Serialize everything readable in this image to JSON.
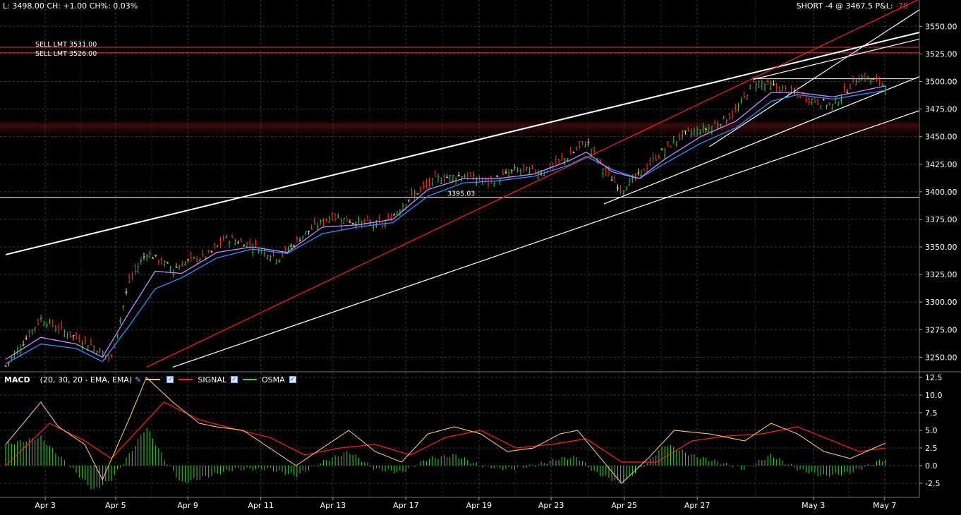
{
  "header": {
    "left": "L: 3498.00 CH: +1.00 CH%: 0.03%",
    "right_prefix": "SHORT -4 @ 3467.5 P&L:",
    "right_pnl": "-78"
  },
  "colors": {
    "background": "#000000",
    "grid": "#3a3a3a",
    "bull_candle": "#3cc33c",
    "bear_candle": "#ff3030",
    "doji": "#ffffff",
    "ema_fast": "#c58cff",
    "ema_slow": "#2f8fff",
    "macd_line": "#f5c46a",
    "signal_line": "#ff2020",
    "osma": "#39d639",
    "trend_red": "#ff2020",
    "trend_white": "#ffffff",
    "shade_zone": "#3d0c0c"
  },
  "orders": [
    {
      "label": "SELL LMT 3531.00",
      "price": 3531
    },
    {
      "label": "SELL LMT 3526.00",
      "price": 3526
    }
  ],
  "annotation": {
    "label": "3395.03",
    "price": 3395.03
  },
  "legend": {
    "name": "MACD",
    "params": "(20, 30, 20 - EMA, EMA)",
    "signal": "SIGNAL",
    "osma": "OSMA"
  },
  "chart_data": [
    {
      "type": "candlestick",
      "title": "",
      "x_tick_labels": [
        "Apr 3",
        "Apr 5",
        "Apr 9",
        "Apr 11",
        "Apr 13",
        "Apr 17",
        "Apr 19",
        "Apr 23",
        "Apr 25",
        "Apr 27",
        "May 3",
        "May 7"
      ],
      "y_tick_labels": [
        "3550.00",
        "3525.00",
        "3500.00",
        "3475.00",
        "3450.00",
        "3425.00",
        "3400.00",
        "3375.00",
        "3350.00",
        "3325.00",
        "3300.00",
        "3275.00",
        "3250.00"
      ],
      "ylim": [
        3240,
        3563
      ],
      "grid": true,
      "close_path": [
        {
          "t": 0,
          "v": 3242
        },
        {
          "t": 0.04,
          "v": 3285
        },
        {
          "t": 0.07,
          "v": 3272
        },
        {
          "t": 0.1,
          "v": 3260
        },
        {
          "t": 0.12,
          "v": 3248
        },
        {
          "t": 0.14,
          "v": 3318
        },
        {
          "t": 0.16,
          "v": 3345
        },
        {
          "t": 0.19,
          "v": 3330
        },
        {
          "t": 0.21,
          "v": 3338
        },
        {
          "t": 0.23,
          "v": 3342
        },
        {
          "t": 0.25,
          "v": 3358
        },
        {
          "t": 0.28,
          "v": 3352
        },
        {
          "t": 0.31,
          "v": 3340
        },
        {
          "t": 0.34,
          "v": 3362
        },
        {
          "t": 0.37,
          "v": 3378
        },
        {
          "t": 0.4,
          "v": 3372
        },
        {
          "t": 0.43,
          "v": 3370
        },
        {
          "t": 0.46,
          "v": 3395
        },
        {
          "t": 0.49,
          "v": 3412
        },
        {
          "t": 0.52,
          "v": 3415
        },
        {
          "t": 0.55,
          "v": 3408
        },
        {
          "t": 0.58,
          "v": 3420
        },
        {
          "t": 0.61,
          "v": 3418
        },
        {
          "t": 0.64,
          "v": 3432
        },
        {
          "t": 0.66,
          "v": 3446
        },
        {
          "t": 0.68,
          "v": 3420
        },
        {
          "t": 0.7,
          "v": 3402
        },
        {
          "t": 0.72,
          "v": 3415
        },
        {
          "t": 0.74,
          "v": 3432
        },
        {
          "t": 0.77,
          "v": 3452
        },
        {
          "t": 0.8,
          "v": 3458
        },
        {
          "t": 0.83,
          "v": 3472
        },
        {
          "t": 0.85,
          "v": 3500
        },
        {
          "t": 0.88,
          "v": 3494
        },
        {
          "t": 0.91,
          "v": 3485
        },
        {
          "t": 0.94,
          "v": 3478
        },
        {
          "t": 0.97,
          "v": 3505
        },
        {
          "t": 1.0,
          "v": 3498
        }
      ],
      "ema_fast_path": [
        {
          "t": 0,
          "v": 3248
        },
        {
          "t": 0.04,
          "v": 3268
        },
        {
          "t": 0.08,
          "v": 3262
        },
        {
          "t": 0.11,
          "v": 3250
        },
        {
          "t": 0.14,
          "v": 3290
        },
        {
          "t": 0.17,
          "v": 3328
        },
        {
          "t": 0.2,
          "v": 3326
        },
        {
          "t": 0.24,
          "v": 3345
        },
        {
          "t": 0.28,
          "v": 3350
        },
        {
          "t": 0.32,
          "v": 3345
        },
        {
          "t": 0.36,
          "v": 3368
        },
        {
          "t": 0.4,
          "v": 3370
        },
        {
          "t": 0.44,
          "v": 3375
        },
        {
          "t": 0.48,
          "v": 3402
        },
        {
          "t": 0.52,
          "v": 3412
        },
        {
          "t": 0.56,
          "v": 3412
        },
        {
          "t": 0.6,
          "v": 3416
        },
        {
          "t": 0.64,
          "v": 3428
        },
        {
          "t": 0.66,
          "v": 3436
        },
        {
          "t": 0.69,
          "v": 3418
        },
        {
          "t": 0.72,
          "v": 3412
        },
        {
          "t": 0.75,
          "v": 3430
        },
        {
          "t": 0.79,
          "v": 3450
        },
        {
          "t": 0.83,
          "v": 3464
        },
        {
          "t": 0.87,
          "v": 3490
        },
        {
          "t": 0.9,
          "v": 3490
        },
        {
          "t": 0.94,
          "v": 3486
        },
        {
          "t": 1.0,
          "v": 3496
        }
      ],
      "ema_slow_path": [
        {
          "t": 0,
          "v": 3244
        },
        {
          "t": 0.04,
          "v": 3262
        },
        {
          "t": 0.08,
          "v": 3258
        },
        {
          "t": 0.11,
          "v": 3246
        },
        {
          "t": 0.14,
          "v": 3278
        },
        {
          "t": 0.17,
          "v": 3312
        },
        {
          "t": 0.2,
          "v": 3322
        },
        {
          "t": 0.24,
          "v": 3340
        },
        {
          "t": 0.28,
          "v": 3348
        },
        {
          "t": 0.32,
          "v": 3344
        },
        {
          "t": 0.36,
          "v": 3362
        },
        {
          "t": 0.4,
          "v": 3368
        },
        {
          "t": 0.44,
          "v": 3372
        },
        {
          "t": 0.48,
          "v": 3396
        },
        {
          "t": 0.52,
          "v": 3408
        },
        {
          "t": 0.56,
          "v": 3410
        },
        {
          "t": 0.6,
          "v": 3414
        },
        {
          "t": 0.64,
          "v": 3424
        },
        {
          "t": 0.66,
          "v": 3432
        },
        {
          "t": 0.69,
          "v": 3420
        },
        {
          "t": 0.72,
          "v": 3412
        },
        {
          "t": 0.75,
          "v": 3426
        },
        {
          "t": 0.79,
          "v": 3444
        },
        {
          "t": 0.83,
          "v": 3458
        },
        {
          "t": 0.87,
          "v": 3482
        },
        {
          "t": 0.9,
          "v": 3488
        },
        {
          "t": 0.94,
          "v": 3484
        },
        {
          "t": 1.0,
          "v": 3492
        }
      ],
      "horizontal_levels": [
        3531,
        3526,
        3502.5,
        3395.03
      ],
      "shaded_zone": {
        "from": 3445,
        "to": 3467
      },
      "trend_lines": [
        {
          "color": "white",
          "from": {
            "t": 0,
            "v": 3343
          },
          "to": {
            "t": 1.0,
            "v": 3537
          }
        },
        {
          "color": "red",
          "from": {
            "t": 0.16,
            "v": 3241
          },
          "to": {
            "t": 1.0,
            "v": 3560
          }
        },
        {
          "color": "white",
          "from": {
            "t": 0.19,
            "v": 3241
          },
          "to": {
            "t": 1.0,
            "v": 3463
          }
        },
        {
          "color": "white",
          "from": {
            "t": 0.68,
            "v": 3389
          },
          "to": {
            "t": 1.0,
            "v": 3492
          }
        },
        {
          "color": "white",
          "from": {
            "t": 0.8,
            "v": 3441
          },
          "to": {
            "t": 1.0,
            "v": 3545
          }
        },
        {
          "color": "white",
          "from": {
            "t": 0.85,
            "v": 3502
          },
          "to": {
            "t": 1.0,
            "v": 3531
          }
        }
      ]
    },
    {
      "type": "line",
      "title": "MACD (20, 30, 20 - EMA, EMA)",
      "y_tick_labels": [
        "12.5",
        "10.0",
        "7.5",
        "5.0",
        "2.5",
        "0.0",
        "-2.5"
      ],
      "ylim": [
        -4.5,
        13
      ],
      "series": [
        {
          "name": "MACD",
          "values_path": [
            {
              "t": 0,
              "v": 3.0
            },
            {
              "t": 0.04,
              "v": 9.0
            },
            {
              "t": 0.06,
              "v": 5.5
            },
            {
              "t": 0.09,
              "v": 3.0
            },
            {
              "t": 0.11,
              "v": -2.0
            },
            {
              "t": 0.14,
              "v": 6.5
            },
            {
              "t": 0.16,
              "v": 12.5
            },
            {
              "t": 0.19,
              "v": 9.0
            },
            {
              "t": 0.22,
              "v": 6.0
            },
            {
              "t": 0.24,
              "v": 5.5
            },
            {
              "t": 0.27,
              "v": 5.0
            },
            {
              "t": 0.3,
              "v": 2.5
            },
            {
              "t": 0.33,
              "v": 0.0
            },
            {
              "t": 0.36,
              "v": 2.5
            },
            {
              "t": 0.39,
              "v": 5.0
            },
            {
              "t": 0.42,
              "v": 2.0
            },
            {
              "t": 0.45,
              "v": 0.5
            },
            {
              "t": 0.48,
              "v": 4.5
            },
            {
              "t": 0.51,
              "v": 5.5
            },
            {
              "t": 0.54,
              "v": 4.5
            },
            {
              "t": 0.57,
              "v": 2.0
            },
            {
              "t": 0.6,
              "v": 2.5
            },
            {
              "t": 0.63,
              "v": 4.5
            },
            {
              "t": 0.65,
              "v": 5.0
            },
            {
              "t": 0.67,
              "v": 2.0
            },
            {
              "t": 0.7,
              "v": -2.5
            },
            {
              "t": 0.73,
              "v": 1.0
            },
            {
              "t": 0.76,
              "v": 5.0
            },
            {
              "t": 0.8,
              "v": 4.5
            },
            {
              "t": 0.84,
              "v": 3.5
            },
            {
              "t": 0.87,
              "v": 6.0
            },
            {
              "t": 0.9,
              "v": 4.5
            },
            {
              "t": 0.93,
              "v": 2.0
            },
            {
              "t": 0.96,
              "v": 1.0
            },
            {
              "t": 1.0,
              "v": 3.2
            }
          ]
        },
        {
          "name": "SIGNAL",
          "values_path": [
            {
              "t": 0,
              "v": 0.0
            },
            {
              "t": 0.05,
              "v": 6.0
            },
            {
              "t": 0.09,
              "v": 3.5
            },
            {
              "t": 0.12,
              "v": 1.0
            },
            {
              "t": 0.15,
              "v": 5.0
            },
            {
              "t": 0.18,
              "v": 9.0
            },
            {
              "t": 0.22,
              "v": 6.5
            },
            {
              "t": 0.26,
              "v": 5.2
            },
            {
              "t": 0.3,
              "v": 4.0
            },
            {
              "t": 0.34,
              "v": 1.5
            },
            {
              "t": 0.38,
              "v": 2.5
            },
            {
              "t": 0.42,
              "v": 3.0
            },
            {
              "t": 0.46,
              "v": 1.5
            },
            {
              "t": 0.5,
              "v": 4.0
            },
            {
              "t": 0.54,
              "v": 5.0
            },
            {
              "t": 0.58,
              "v": 2.5
            },
            {
              "t": 0.62,
              "v": 3.0
            },
            {
              "t": 0.66,
              "v": 3.8
            },
            {
              "t": 0.7,
              "v": 0.5
            },
            {
              "t": 0.74,
              "v": 0.5
            },
            {
              "t": 0.78,
              "v": 3.5
            },
            {
              "t": 0.82,
              "v": 4.2
            },
            {
              "t": 0.86,
              "v": 4.5
            },
            {
              "t": 0.9,
              "v": 5.5
            },
            {
              "t": 0.94,
              "v": 3.5
            },
            {
              "t": 0.97,
              "v": 2.0
            },
            {
              "t": 1.0,
              "v": 2.5
            }
          ]
        },
        {
          "name": "OSMA",
          "type": "histogram",
          "values_path": [
            {
              "t": 0,
              "v": 3.0
            },
            {
              "t": 0.04,
              "v": 4.0
            },
            {
              "t": 0.06,
              "v": 1.5
            },
            {
              "t": 0.08,
              "v": -1.0
            },
            {
              "t": 0.1,
              "v": -3.5
            },
            {
              "t": 0.12,
              "v": -2.0
            },
            {
              "t": 0.14,
              "v": 1.5
            },
            {
              "t": 0.16,
              "v": 5.5
            },
            {
              "t": 0.18,
              "v": 1.0
            },
            {
              "t": 0.2,
              "v": -2.5
            },
            {
              "t": 0.23,
              "v": -1.5
            },
            {
              "t": 0.26,
              "v": -0.5
            },
            {
              "t": 0.3,
              "v": -0.5
            },
            {
              "t": 0.33,
              "v": -1.5
            },
            {
              "t": 0.36,
              "v": 0.5
            },
            {
              "t": 0.39,
              "v": 2.0
            },
            {
              "t": 0.42,
              "v": -0.5
            },
            {
              "t": 0.45,
              "v": -1.0
            },
            {
              "t": 0.48,
              "v": 1.0
            },
            {
              "t": 0.51,
              "v": 1.5
            },
            {
              "t": 0.54,
              "v": 0.0
            },
            {
              "t": 0.57,
              "v": -0.5
            },
            {
              "t": 0.6,
              "v": 0.0
            },
            {
              "t": 0.63,
              "v": 1.0
            },
            {
              "t": 0.65,
              "v": 1.2
            },
            {
              "t": 0.67,
              "v": -1.0
            },
            {
              "t": 0.7,
              "v": -2.5
            },
            {
              "t": 0.73,
              "v": 0.5
            },
            {
              "t": 0.75,
              "v": 3.0
            },
            {
              "t": 0.78,
              "v": 1.5
            },
            {
              "t": 0.81,
              "v": 0.5
            },
            {
              "t": 0.84,
              "v": -0.5
            },
            {
              "t": 0.87,
              "v": 1.5
            },
            {
              "t": 0.9,
              "v": -0.5
            },
            {
              "t": 0.93,
              "v": -1.5
            },
            {
              "t": 0.96,
              "v": -1.0
            },
            {
              "t": 1.0,
              "v": 1.0
            }
          ]
        }
      ]
    }
  ]
}
